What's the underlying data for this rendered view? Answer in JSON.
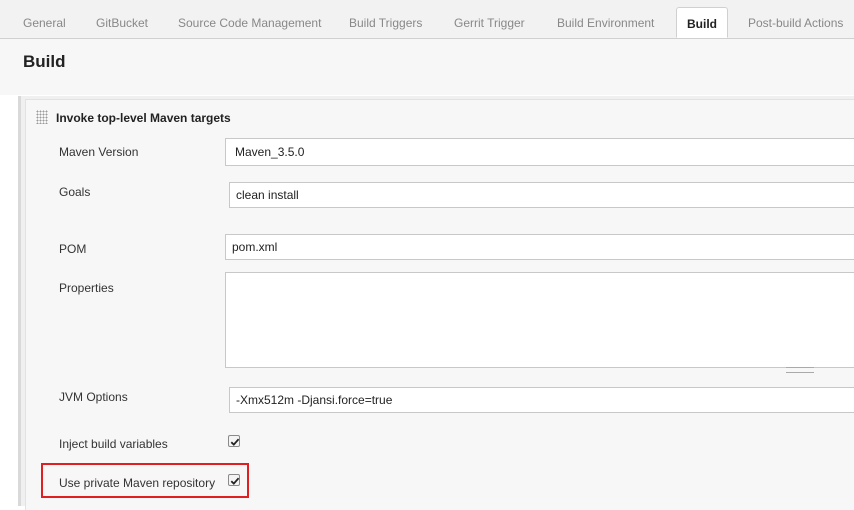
{
  "tabs": [
    {
      "label": "General"
    },
    {
      "label": "GitBucket"
    },
    {
      "label": "Source Code Management"
    },
    {
      "label": "Build Triggers"
    },
    {
      "label": "Gerrit Trigger"
    },
    {
      "label": "Build Environment"
    },
    {
      "label": "Build"
    },
    {
      "label": "Post-build Actions"
    }
  ],
  "active_tab": "Build",
  "section": {
    "title": "Build"
  },
  "step": {
    "title": "Invoke top-level Maven targets",
    "maven_version": {
      "label": "Maven Version",
      "value": "Maven_3.5.0"
    },
    "goals": {
      "label": "Goals",
      "value": "clean install"
    },
    "pom": {
      "label": "POM",
      "value": "pom.xml"
    },
    "properties": {
      "label": "Properties",
      "value": ""
    },
    "jvm_options": {
      "label": "JVM Options",
      "value": "-Xmx512m -Djansi.force=true"
    },
    "inject_build_variables": {
      "label": "Inject build variables",
      "checked": true
    },
    "use_private_repo": {
      "label": "Use private Maven repository",
      "checked": true
    }
  },
  "icons": {
    "drag_handle": "drag-handle-icon",
    "checkmark": "checkmark-icon"
  },
  "colors": {
    "highlight": "#e02020",
    "active_tab_bg": "#ffffff",
    "tab_bar_bg": "#f2f2f2"
  }
}
